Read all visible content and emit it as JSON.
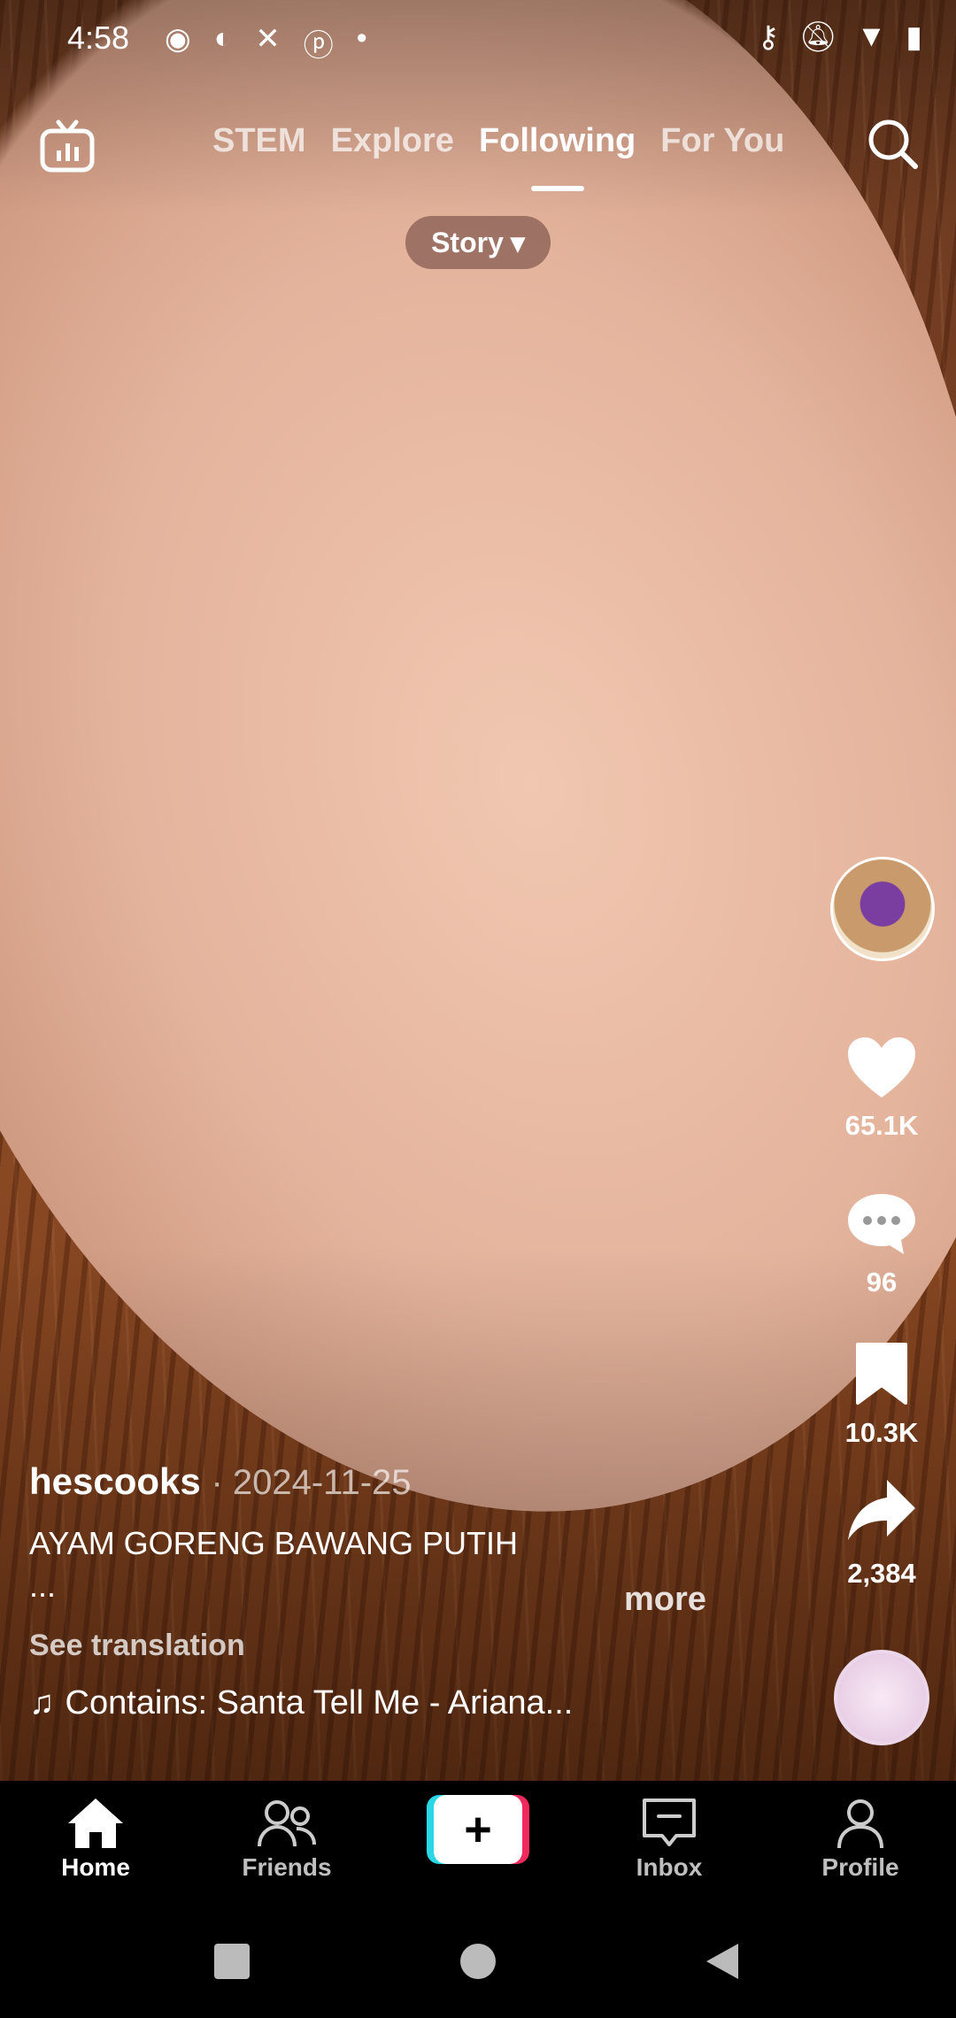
{
  "status_bar": {
    "time": "4:58"
  },
  "top_nav": {
    "tabs": [
      "STEM",
      "Explore",
      "Following",
      "For You"
    ],
    "active_tab": "Following"
  },
  "story_pill": {
    "label": "Story"
  },
  "actions": {
    "likes": "65.1K",
    "comments": "96",
    "saves": "10.3K",
    "shares": "2,384"
  },
  "post": {
    "author": "hescooks",
    "date": "· 2024-11-25",
    "caption_line1": "AYAM GORENG BAWANG PUTIH",
    "caption_line2": "...",
    "more_label": "more",
    "see_translation": "See translation",
    "sound": "Contains: Santa Tell Me - Ariana..."
  },
  "bottom_nav": {
    "items": [
      "Home",
      "Friends",
      "+",
      "Inbox",
      "Profile"
    ],
    "active": "Home"
  },
  "colors": {
    "create_cyan": "#29d7e6",
    "create_pink": "#f12a5d"
  }
}
